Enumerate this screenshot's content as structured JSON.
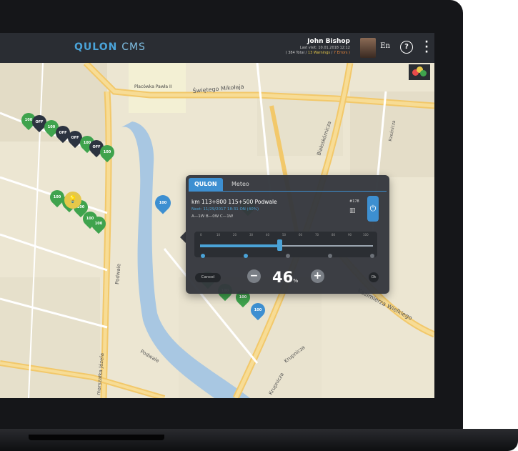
{
  "app": {
    "logo_primary": "QULON",
    "logo_secondary": "CMS"
  },
  "user": {
    "name": "John Bishop",
    "last_visit": "Last visit: 10.01.2018 12:12",
    "stats_total": "( 384 Total /",
    "stats_warnings": "13 Warnings",
    "stats_sep": "/",
    "stats_errors": "7 Errors )",
    "language": "En"
  },
  "header": {
    "help_icon": "?",
    "menu_icon": "⋮"
  },
  "map": {
    "street_labels": [
      "Placówka Pawła II",
      "Świętego Mikołaja",
      "Białoskórnicza",
      "Podwale",
      "Kazimierza Wielkiego",
      "Krupnicza",
      "Podwale",
      "marszałka Józefa",
      "Krupnicza",
      "Rzeźnicza"
    ],
    "pins": [
      {
        "label": "100",
        "color": "#3fa34d"
      },
      {
        "label": "OFF",
        "color": "#2c3340"
      },
      {
        "label": "100",
        "color": "#3fa34d"
      },
      {
        "label": "OFF",
        "color": "#2c3340"
      },
      {
        "label": "OFF",
        "color": "#2c3340"
      },
      {
        "label": "100",
        "color": "#3fa34d"
      },
      {
        "label": "OFF",
        "color": "#2c3340"
      },
      {
        "label": "100",
        "color": "#3fa34d"
      },
      {
        "label": "100",
        "color": "#3fa34d"
      },
      {
        "label": "100",
        "color": "#3fa34d"
      },
      {
        "label": "100",
        "color": "#3fa34d"
      },
      {
        "label": "100",
        "color": "#3fa34d"
      },
      {
        "label": "100",
        "color": "#3fa34d"
      },
      {
        "label": "100",
        "color": "#3d8fd1"
      },
      {
        "label": "100",
        "color": "#3fa34d"
      },
      {
        "label": "100",
        "color": "#3fa34d"
      },
      {
        "label": "100",
        "color": "#3fa34d"
      },
      {
        "label": "100",
        "color": "#3fa34d"
      },
      {
        "label": "100",
        "color": "#3d8fd1"
      }
    ],
    "bulb_icon": "lightbulb-icon"
  },
  "popup": {
    "tab_active": "QULON",
    "tab_meteo": "Meteo",
    "title": "km 113+800 115+500 Podwale",
    "next_schedule": "Next: 11/29/2017 18:31 ON (40%)",
    "modes": "A—1W  B—0W  C—1W",
    "device_id": "#178",
    "power_label": "⏻",
    "ticks": [
      "0",
      "10",
      "20",
      "30",
      "40",
      "50",
      "60",
      "70",
      "80",
      "90",
      "100"
    ],
    "level": 46,
    "level_value": "46",
    "level_unit": "%",
    "cancel_label": "Cancel",
    "ok_label": "Ok",
    "minus_label": "−",
    "plus_label": "+"
  },
  "colors": {
    "accent": "#3d8fd1",
    "topbar": "#2a2d33",
    "pin_on": "#3fa34d",
    "pin_off": "#2c3340",
    "pin_selected": "#3d8fd1",
    "warning": "#e6c84a",
    "error": "#e8863b"
  }
}
